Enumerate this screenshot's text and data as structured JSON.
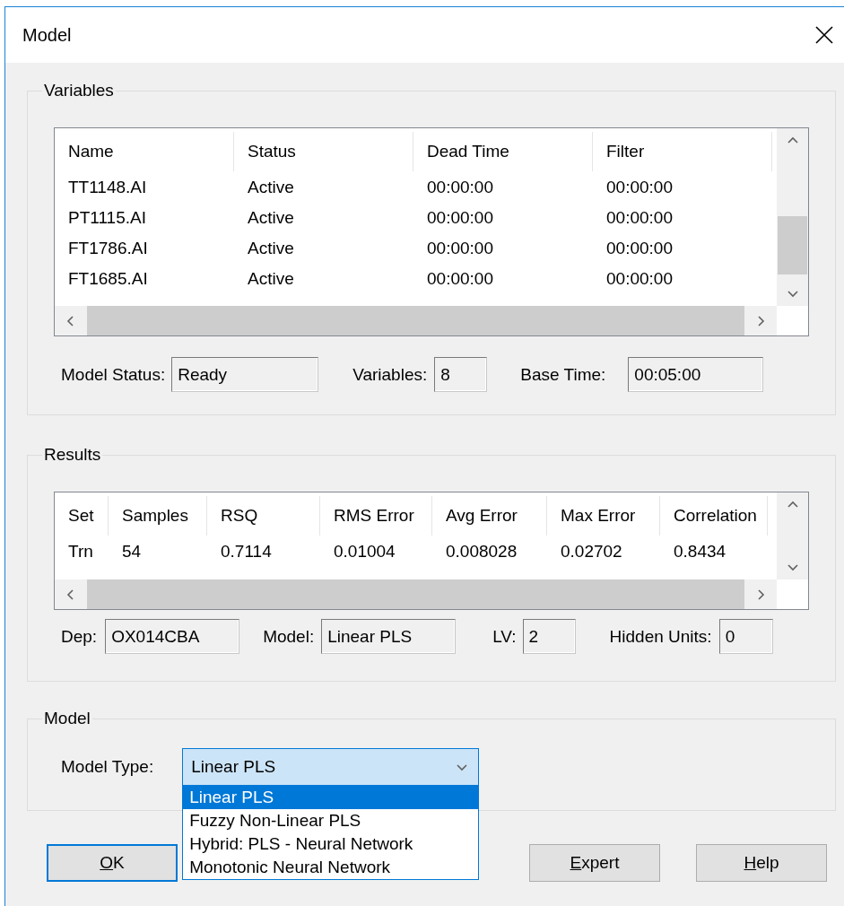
{
  "window": {
    "title": "Model"
  },
  "variables": {
    "title": "Variables",
    "columns": [
      "Name",
      "Status",
      "Dead Time",
      "Filter"
    ],
    "rows": [
      [
        "TT1148.AI",
        "Active",
        "00:00:00",
        "00:00:00"
      ],
      [
        "PT1115.AI",
        "Active",
        "00:00:00",
        "00:00:00"
      ],
      [
        "FT1786.AI",
        "Active",
        "00:00:00",
        "00:00:00"
      ],
      [
        "FT1685.AI",
        "Active",
        "00:00:00",
        "00:00:00"
      ]
    ],
    "fields": [
      {
        "label": "Model Status:",
        "value": "Ready"
      },
      {
        "label": "Variables:",
        "value": "8"
      },
      {
        "label": "Base Time:",
        "value": "00:05:00"
      }
    ]
  },
  "results": {
    "title": "Results",
    "columns": [
      "Set",
      "Samples",
      "RSQ",
      "RMS Error",
      "Avg Error",
      "Max Error",
      "Correlation"
    ],
    "rows": [
      [
        "Trn",
        "54",
        "0.7114",
        "0.01004",
        "0.008028",
        "0.02702",
        "0.8434"
      ]
    ],
    "fields": [
      {
        "label": "Dep:",
        "value": "OX014CBA"
      },
      {
        "label": "Model:",
        "value": "Linear PLS"
      },
      {
        "label": "LV:",
        "value": "2"
      },
      {
        "label": "Hidden Units:",
        "value": "0"
      }
    ]
  },
  "model": {
    "title": "Model",
    "model_type": {
      "label": "Model Type:",
      "value": "Linear PLS",
      "expanded": true,
      "options": [
        {
          "label": "Linear PLS",
          "selected": true
        },
        {
          "label": "Fuzzy Non-Linear PLS",
          "selected": false
        },
        {
          "label": "Hybrid: PLS - Neural Network",
          "selected": false
        },
        {
          "label": "Monotonic Neural Network",
          "selected": false
        }
      ]
    }
  },
  "buttons": [
    {
      "label": "OK",
      "mnemonic": true,
      "default": true
    },
    {
      "label": "Expert",
      "mnemonic": true,
      "default": false
    },
    {
      "label": "Help",
      "mnemonic": true,
      "default": false
    }
  ]
}
